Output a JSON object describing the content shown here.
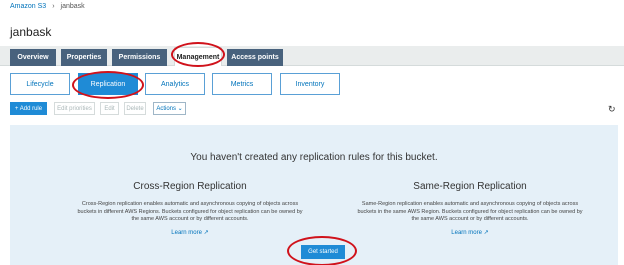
{
  "breadcrumb": {
    "root": "Amazon S3",
    "separator": "›",
    "current": "janbask"
  },
  "bucket": {
    "title": "janbask"
  },
  "tabs": [
    {
      "label": "Overview"
    },
    {
      "label": "Properties"
    },
    {
      "label": "Permissions"
    },
    {
      "label": "Management"
    },
    {
      "label": "Access points"
    }
  ],
  "subtabs": [
    {
      "label": "Lifecycle"
    },
    {
      "label": "Replication"
    },
    {
      "label": "Analytics"
    },
    {
      "label": "Metrics"
    },
    {
      "label": "Inventory"
    }
  ],
  "toolbar": {
    "add_rule": "+ Add rule",
    "edit_priorities": "Edit priorities",
    "edit": "Edit",
    "delete": "Delete",
    "actions": "Actions ⌄",
    "refresh_icon": "↻"
  },
  "empty_state": {
    "heading": "You haven't created any replication rules for this bucket.",
    "cross_region": {
      "title": "Cross-Region Replication",
      "description": "Cross-Region replication enables automatic and asynchronous copying of objects across buckets in different AWS Regions. Buckets configured for object replication can be owned by the same AWS account or by different accounts.",
      "link": "Learn more ↗"
    },
    "same_region": {
      "title": "Same-Region Replication",
      "description": "Same-Region replication enables automatic and asynchronous copying of objects across buckets in the same AWS Region. Buckets configured for object replication can be owned by the same AWS account or by different accounts.",
      "link": "Learn more ↗"
    },
    "get_started": "Get started"
  },
  "colors": {
    "tab_bg": "#48627d",
    "accent": "#1f8bd6",
    "annotation": "#d0121b",
    "panel_bg": "#e5f0f8"
  }
}
